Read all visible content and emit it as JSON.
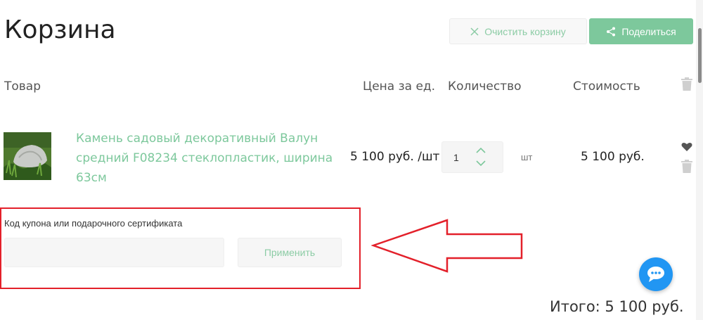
{
  "header": {
    "title": "Корзина",
    "clear_label": "Очистить корзину",
    "share_label": "Поделиться"
  },
  "table": {
    "columns": {
      "product": "Товар",
      "price": "Цена за ед.",
      "quantity": "Количество",
      "cost": "Стоимость"
    }
  },
  "item": {
    "name": "Камень садовый декоративный Валун средний F08234 стеклопластик, ширина 63см",
    "price": "5 100 руб. /шт",
    "quantity": "1",
    "unit": "шт",
    "cost": "5 100 руб."
  },
  "coupon": {
    "label": "Код купона или подарочного сертификата",
    "value": "",
    "placeholder": "",
    "apply_label": "Применить"
  },
  "total": "Итого: 5 100 руб.",
  "colors": {
    "accent": "#7dc89c",
    "annotation": "#e3202a",
    "chat": "#2196f3"
  },
  "icons": {
    "clear": "close-icon",
    "share": "share-icon",
    "delete": "trash-icon",
    "favorite": "heart-icon",
    "increase": "chevron-up-icon",
    "decrease": "chevron-down-icon",
    "chat": "chat-bubble-icon"
  }
}
